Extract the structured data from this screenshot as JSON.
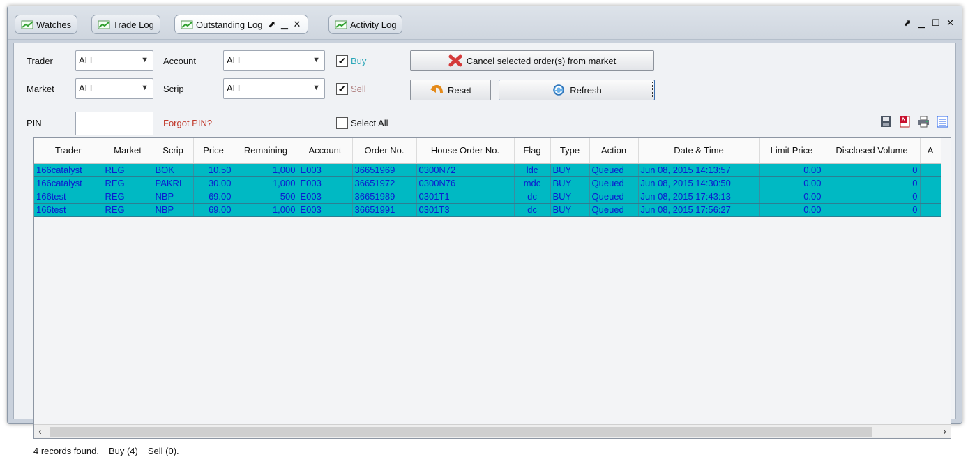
{
  "tabs": [
    {
      "label": "Watches"
    },
    {
      "label": "Trade Log"
    },
    {
      "label": "Outstanding Log",
      "controls": "⬈ ▁ ✕"
    },
    {
      "label": "Activity Log"
    }
  ],
  "window_controls": "⬈ ▁ ☐ ✕",
  "filters": {
    "trader_label": "Trader",
    "trader_value": "ALL",
    "market_label": "Market",
    "market_value": "ALL",
    "pin_label": "PIN",
    "forgot_pin": "Forgot PIN?",
    "account_label": "Account",
    "account_value": "ALL",
    "scrip_label": "Scrip",
    "scrip_value": "ALL",
    "buy_label": "Buy",
    "buy_checked": "✔",
    "sell_label": "Sell",
    "sell_checked": "✔",
    "select_all_label": "Select All"
  },
  "buttons": {
    "cancel": "Cancel selected order(s) from market",
    "reset": "Reset",
    "refresh": "Refresh"
  },
  "colors": {
    "row_bg": "#00b9c3",
    "row_text": "#0a1cd0",
    "buy_label": "#2aa6b8",
    "sell_label": "#b08080",
    "forgot_pin": "#c0392b"
  },
  "grid": {
    "columns": [
      "Trader",
      "Market",
      "Scrip",
      "Price",
      "Remaining",
      "Account",
      "Order No.",
      "House Order No.",
      "Flag",
      "Type",
      "Action",
      "Date & Time",
      "Limit Price",
      "Disclosed Volume",
      "A"
    ],
    "rows": [
      [
        "166catalyst",
        "REG",
        "BOK",
        "10.50",
        "1,000",
        "E003",
        "36651969",
        "0300N72",
        "ldc",
        "BUY",
        "Queued",
        "Jun 08, 2015 14:13:57",
        "0.00",
        "0",
        ""
      ],
      [
        "166catalyst",
        "REG",
        "PAKRI",
        "30.00",
        "1,000",
        "E003",
        "36651972",
        "0300N76",
        "mdc",
        "BUY",
        "Queued",
        "Jun 08, 2015 14:30:50",
        "0.00",
        "0",
        ""
      ],
      [
        "166test",
        "REG",
        "NBP",
        "69.00",
        "500",
        "E003",
        "36651989",
        "0301T1",
        "dc",
        "BUY",
        "Queued",
        "Jun 08, 2015 17:43:13",
        "0.00",
        "0",
        ""
      ],
      [
        "166test",
        "REG",
        "NBP",
        "69.00",
        "1,000",
        "E003",
        "36651991",
        "0301T3",
        "dc",
        "BUY",
        "Queued",
        "Jun 08, 2015 17:56:27",
        "0.00",
        "0",
        ""
      ]
    ]
  },
  "status": {
    "records": "4 records found.",
    "buy": "Buy (4)",
    "sell": "Sell (0)."
  }
}
